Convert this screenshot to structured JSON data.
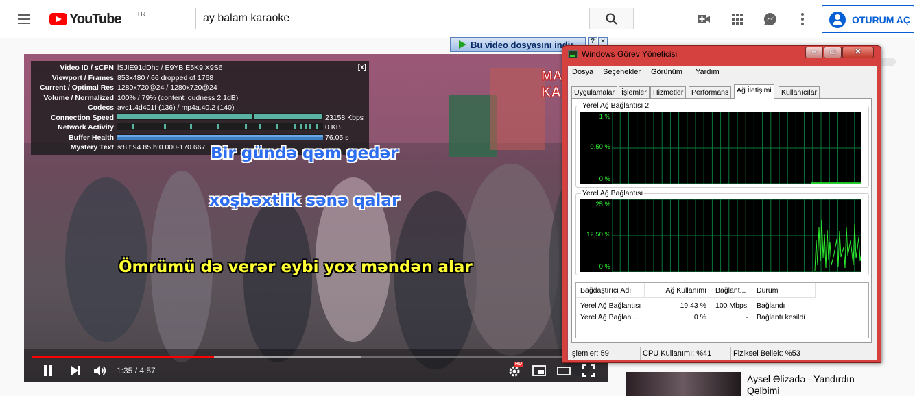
{
  "youtube": {
    "logo_text": "YouTube",
    "country_code": "TR",
    "search_value": "ay balam karaoke",
    "signin_label": "OTURUM AÇ"
  },
  "download_banner": {
    "label": "Bu video dosyasını indir",
    "help": "?",
    "close": "×"
  },
  "video": {
    "stats": [
      {
        "key": "Video ID / sCPN",
        "value": "lSJIE91dDhc / E9YB E5K9 X9S6"
      },
      {
        "key": "Viewport / Frames",
        "value": "853x480 / 66 dropped of 1768"
      },
      {
        "key": "Current / Optimal Res",
        "value": "1280x720@24 / 1280x720@24"
      },
      {
        "key": "Volume / Normalized",
        "value": "100% / 79% (content loudness 2.1dB)"
      },
      {
        "key": "Codecs",
        "value": "avc1.4d401f (136) / mp4a.40.2 (140)"
      },
      {
        "key": "Connection Speed",
        "value": "23158 Kbps"
      },
      {
        "key": "Network Activity",
        "value": "0 KB"
      },
      {
        "key": "Buffer Health",
        "value": "76.05 s"
      },
      {
        "key": "Mystery Text",
        "value": "s:8 t:94.85 b:0.000-170.667"
      }
    ],
    "stats_close": "[x]",
    "lyrics": [
      "Bir gündə qəm gedər",
      "xoşbəxtlik sənə qalar",
      "Ömrümü də verər eybi yox məndən alar"
    ],
    "corner_text": [
      "MA",
      "KA"
    ],
    "time_label": "1:35 / 4:57",
    "progress": 0.32,
    "buffered": 0.58,
    "hd_badge": "HD"
  },
  "sidebar": {
    "next_title": "Aysel Əlizadə - Yandırdın Qəlbimi"
  },
  "task_manager": {
    "title": "Windows Görev Yöneticisi",
    "menu": [
      "Dosya",
      "Seçenekler",
      "Görünüm",
      "Yardım"
    ],
    "tabs": [
      "Uygulamalar",
      "İşlemler",
      "Hizmetler",
      "Performans",
      "Ağ İletişimi",
      "Kullanıcılar"
    ],
    "active_tab": "Ağ İletişimi",
    "graph1": {
      "title": "Yerel Ağ Bağlantısı 2",
      "ticks": [
        "1 %",
        "0,50 %",
        "0 %"
      ]
    },
    "graph2": {
      "title": "Yerel Ağ Bağlantısı",
      "ticks": [
        "25 %",
        "12,50 %",
        "0 %"
      ]
    },
    "columns": [
      "Bağdaştırıcı Adı",
      "Ağ Kullanımı",
      "Bağlant...",
      "Durum"
    ],
    "rows": [
      [
        "Yerel Ağ Bağlantısı",
        "19,43 %",
        "100 Mbps",
        "Bağlandı"
      ],
      [
        "Yerel Ağ Bağlan...",
        "0 %",
        "-",
        "Bağlantı kesildi"
      ]
    ],
    "status": {
      "processes": "İşlemler: 59",
      "cpu": "CPU Kullanımı: %41",
      "memory": "Fiziksel Bellek: %53"
    },
    "line_color": "#2ef02e",
    "grid_color": "#0a7a3a"
  }
}
